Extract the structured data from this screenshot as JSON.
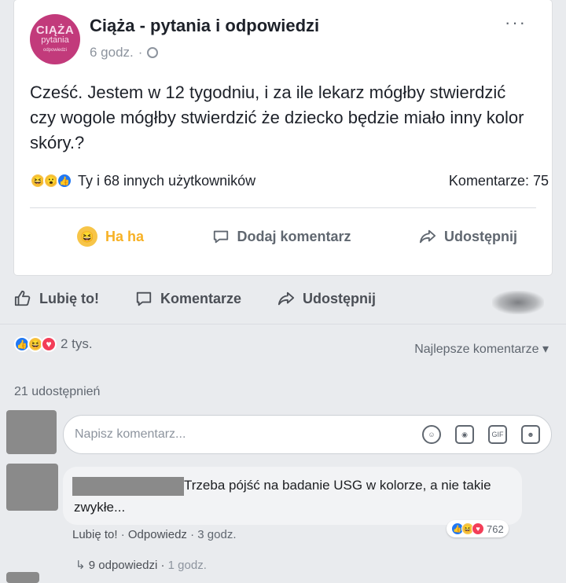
{
  "shared_post": {
    "logo": {
      "line1": "CIĄŻA",
      "line2": "pytania",
      "line3": "odpowiedzi"
    },
    "group_name": "Ciąża - pytania i odpowiedzi",
    "time": "6 godz.",
    "separator": "·",
    "more": "···",
    "text": "Cześć. Jestem w 12 tygodniu, i za ile lekarz mógłby stwierdzić czy wogole mógłby stwierdzić że dziecko będzie miało inny kolor skóry.?",
    "reactions_label": "Ty i 68 innych użytkowników",
    "comments_label": "Komentarze: 75",
    "actions": {
      "haha": "Ha ha",
      "comment": "Dodaj komentarz",
      "share": "Udostępnij"
    }
  },
  "outer": {
    "actions": {
      "like": "Lubię to!",
      "comment": "Komentarze",
      "share": "Udostępnij"
    },
    "reactions_count": "2 tys.",
    "sort_label": "Najlepsze komentarze ▾",
    "shares": "21 udostępnień",
    "compose_placeholder": "Napisz komentarz..."
  },
  "comment": {
    "text": "Trzeba pójść na badanie USG w kolorze, a nie takie zwykłe...",
    "reaction_count": "762",
    "like": "Lubię to!",
    "reply": "Odpowiedz",
    "time": "3 godz.",
    "dot": "·"
  },
  "replies": {
    "label": "9 odpowiedzi",
    "time": "1 godz."
  },
  "colors": {
    "like_blue": "#2078f4",
    "haha_yellow": "#f7c548",
    "love_red": "#f33e58",
    "logo_pink": "#c23a7b"
  }
}
